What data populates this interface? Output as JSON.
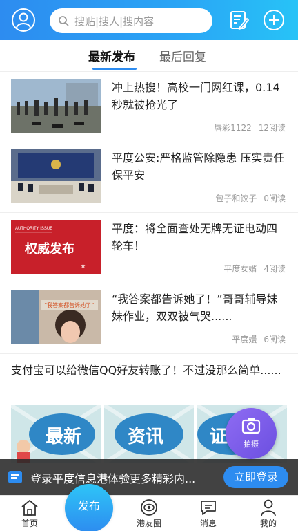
{
  "header": {
    "search_placeholder": "搜贴|搜人|搜内容",
    "icons": [
      "user-avatar-icon",
      "search-icon",
      "edit-post-icon",
      "add-icon"
    ]
  },
  "tabs": [
    {
      "label": "最新发布",
      "active": true
    },
    {
      "label": "最后回复",
      "active": false
    }
  ],
  "news": [
    {
      "title": "冲上热搜！高校一门网红课，0.14秒就被抢光了",
      "author": "唇彩1122",
      "reads": "12阅读"
    },
    {
      "title": "平度公安:严格监管除隐患 压实责任保平安",
      "author": "包子和饺子",
      "reads": "0阅读"
    },
    {
      "title": "平度：将全面查处无牌无证电动四轮车！",
      "author": "平度女婿",
      "reads": "4阅读",
      "thumb_small": "AUTHORITY ISSUE",
      "thumb_big": "权威发布"
    },
    {
      "title": "“我答案都告诉她了！”哥哥辅导妹妹作业，双双被气哭......",
      "author": "平度嫚",
      "reads": "6阅读",
      "thumb_caption": "“我答案都告诉她了”"
    }
  ],
  "article": {
    "title": "支付宝可以给微信QQ好友转账了！不过没那么简单......",
    "tiles": [
      "最新",
      "资讯",
      "证"
    ]
  },
  "fab": {
    "label": "拍摄"
  },
  "login_bar": {
    "text": "登录平度信息港体验更多精彩内...",
    "button": "立即登录"
  },
  "bottom_nav": {
    "items": [
      {
        "label": "首页",
        "icon": "home-icon"
      },
      {
        "label": "港友圈",
        "icon": "eye-circle-icon"
      },
      {
        "label": "消息",
        "icon": "message-icon"
      },
      {
        "label": "我的",
        "icon": "profile-icon"
      }
    ],
    "publish": "发布"
  },
  "colors": {
    "accent": "#2d8cf0",
    "header_gradient_end": "#27c3f7",
    "fab": "#7b5cec",
    "thumb_red": "#c8202a"
  }
}
